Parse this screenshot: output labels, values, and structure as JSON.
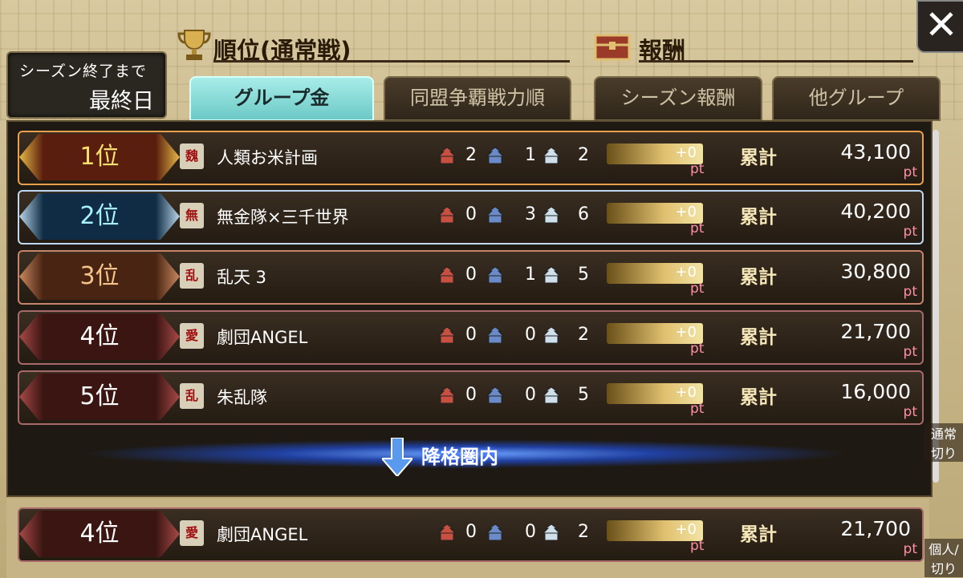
{
  "season": {
    "line1": "シーズン終了まで",
    "line2": "最終日"
  },
  "headings": {
    "ranking": "順位(通常戦)",
    "reward": "報酬"
  },
  "tabs": [
    {
      "label": "グループ金",
      "active": true
    },
    {
      "label": "同盟争覇戦力順",
      "active": false
    },
    {
      "label": "シーズン報酬",
      "active": false
    },
    {
      "label": "他グループ",
      "active": false
    }
  ],
  "close_label": "✕",
  "rows": [
    {
      "rank": "1位",
      "emblem": "魏",
      "name": "人類お米計画",
      "c1": "2",
      "c2": "1",
      "c3": "2",
      "gain": "+0",
      "unit": "pt",
      "total_label": "累計",
      "total": "43,100",
      "total_unit": "pt"
    },
    {
      "rank": "2位",
      "emblem": "無",
      "name": "無金隊×三千世界",
      "c1": "0",
      "c2": "3",
      "c3": "6",
      "gain": "+0",
      "unit": "pt",
      "total_label": "累計",
      "total": "40,200",
      "total_unit": "pt"
    },
    {
      "rank": "3位",
      "emblem": "乱",
      "name": "乱天 3",
      "c1": "0",
      "c2": "1",
      "c3": "5",
      "gain": "+0",
      "unit": "pt",
      "total_label": "累計",
      "total": "30,800",
      "total_unit": "pt"
    },
    {
      "rank": "4位",
      "emblem": "愛",
      "name": "劇団ANGEL",
      "c1": "0",
      "c2": "0",
      "c3": "2",
      "gain": "+0",
      "unit": "pt",
      "total_label": "累計",
      "total": "21,700",
      "total_unit": "pt"
    },
    {
      "rank": "5位",
      "emblem": "乱",
      "name": "朱乱隊",
      "c1": "0",
      "c2": "0",
      "c3": "5",
      "gain": "+0",
      "unit": "pt",
      "total_label": "累計",
      "total": "16,000",
      "total_unit": "pt"
    }
  ],
  "demotion_label": "降格圏内",
  "my_row": {
    "rank": "4位",
    "emblem": "愛",
    "name": "劇団ANGEL",
    "c1": "0",
    "c2": "0",
    "c3": "2",
    "gain": "+0",
    "unit": "pt",
    "total_label": "累計",
    "total": "21,700",
    "total_unit": "pt"
  },
  "side_buttons": [
    {
      "label": "通常\n切り"
    },
    {
      "label": "個人/\n切り"
    }
  ],
  "colors": {
    "castle_red": "#c85040",
    "castle_blue": "#6a8ac8",
    "castle_white": "#cfe0ea"
  }
}
